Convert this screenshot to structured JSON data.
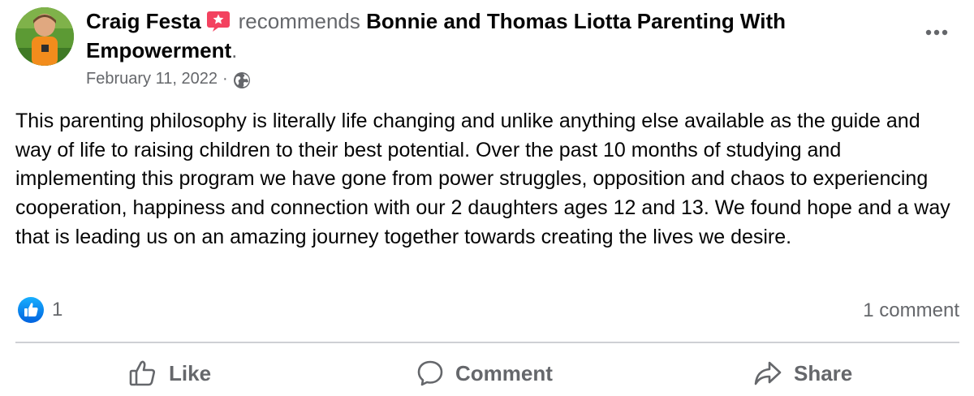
{
  "post": {
    "author": "Craig Festa",
    "recommend_icon": "recommend-star-badge-icon",
    "verb": "recommends",
    "page": "Bonnie and Thomas Liotta Parenting With Empowerment",
    "page_suffix": ".",
    "date": "February 11, 2022",
    "date_separator": "·",
    "audience_icon": "globe-icon",
    "more_icon": "ellipsis-icon",
    "body": "This parenting philosophy is literally life changing and unlike anything else available as the guide and way of life to raising children to their best potential. Over the past 10 months of studying and implementing this program we have gone from power struggles, opposition and chaos to experiencing cooperation, happiness and connection with our 2 daughters ages 12 and 13. We found hope and a way that is leading us on an amazing journey together towards creating the lives we desire."
  },
  "stats": {
    "reaction_icon": "like-reaction-icon",
    "reaction_count": "1",
    "comments": "1 comment"
  },
  "actions": {
    "like": {
      "label": "Like",
      "icon": "thumbs-up-icon"
    },
    "comment": {
      "label": "Comment",
      "icon": "comment-bubble-icon"
    },
    "share": {
      "label": "Share",
      "icon": "share-arrow-icon"
    }
  },
  "colors": {
    "text_primary": "#050505",
    "text_secondary": "#65676b",
    "like_blue": "#1877f2",
    "recommend_pink": "#f3425f",
    "divider": "#ced0d4"
  }
}
